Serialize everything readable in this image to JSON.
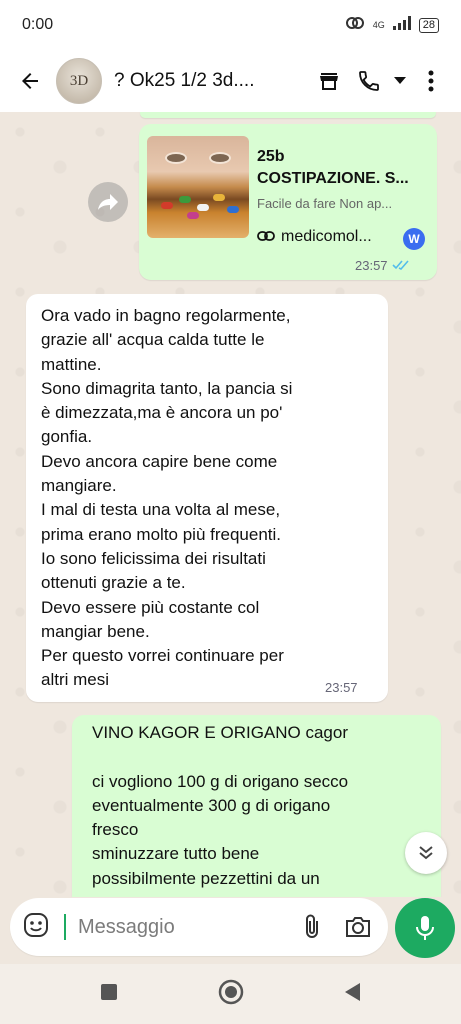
{
  "statusbar": {
    "time": "0:00",
    "network": "4G",
    "battery": "28"
  },
  "header": {
    "avatar_text": "3D",
    "title": "? Ok25 1/2 3d...."
  },
  "messages": {
    "link_card": {
      "title_line1": "25b",
      "title_line2": "COSTIPAZIONE. S...",
      "description": "Facile da fare Non ap...",
      "link": "medicomol...",
      "time": "23:57"
    },
    "incoming": {
      "text": "Ora vado in bagno regolarmente,\ngrazie all' acqua calda tutte le\nmattine.\nSono dimagrita tanto, la pancia si\nè dimezzata,ma è ancora un po'\ngonfia.\nDevo ancora capire bene come\nmangiare.\nI mal di testa una volta al mese,\nprima erano molto più frequenti.\nIo sono felicissima dei risultati\nottenuti grazie a te.\nDevo essere più costante col\nmangiar bene.\nPer questo vorrei continuare per\naltri mesi",
      "time": "23:57"
    },
    "outgoing": {
      "text": "VINO KAGOR E ORIGANO cagor\n\nci vogliono 100 g di origano secco\neventualmente 300 g di origano\nfresco\nsminuzzare tutto bene\npossibilmente pezzettini da un"
    }
  },
  "composer": {
    "placeholder": "Messaggio"
  },
  "colors": {
    "accent": "#1daa61",
    "outgoing_bubble": "#d9fdd3",
    "incoming_bubble": "#ffffff",
    "chat_background": "#efe7de"
  },
  "icons": [
    "back-arrow-icon",
    "shop-icon",
    "phone-icon",
    "dropdown-icon",
    "more-vert-icon",
    "forward-icon",
    "link-icon",
    "wordpress-icon",
    "read-receipt-icon",
    "scroll-down-icon",
    "sticker-icon",
    "attach-icon",
    "camera-icon",
    "mic-icon",
    "nav-square-icon",
    "nav-home-icon",
    "nav-back-icon"
  ]
}
